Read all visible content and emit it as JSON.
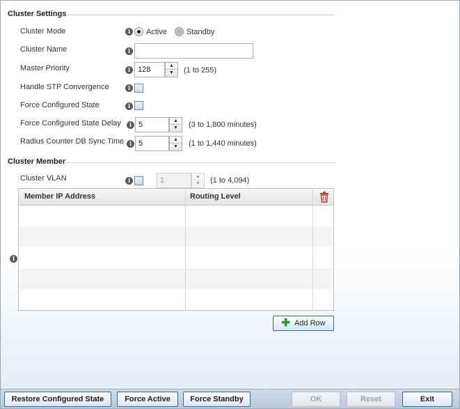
{
  "cluster_settings": {
    "title": "Cluster Settings",
    "cluster_mode": {
      "label": "Cluster Mode",
      "options": [
        "Active",
        "Standby"
      ],
      "selected": "Active"
    },
    "cluster_name": {
      "label": "Cluster Name",
      "value": ""
    },
    "master_priority": {
      "label": "Master Priority",
      "value": "128",
      "range": "(1 to 255)"
    },
    "handle_stp": {
      "label": "Handle STP Convergence",
      "checked": false
    },
    "force_configured_state": {
      "label": "Force Configured State",
      "checked": false
    },
    "force_configured_state_delay": {
      "label": "Force Configured State Delay",
      "value": "5",
      "range": "(3 to 1,800 minutes)"
    },
    "radius_sync_time": {
      "label": "Radius Counter DB Sync Time",
      "value": "5",
      "range": "(1 to 1,440 minutes)"
    }
  },
  "cluster_member": {
    "title": "Cluster Member",
    "cluster_vlan": {
      "label": "Cluster VLAN",
      "checked": false,
      "value": "1",
      "range": "(1 to 4,094)"
    },
    "table": {
      "columns": [
        "Member IP Address",
        "Routing Level"
      ],
      "rows": []
    },
    "add_row_label": "Add Row"
  },
  "footer": {
    "restore_label": "Restore Configured State",
    "force_active_label": "Force Active",
    "force_standby_label": "Force Standby",
    "ok_label": "OK",
    "reset_label": "Reset",
    "exit_label": "Exit"
  },
  "icons": {
    "info": "info-icon",
    "trash": "trash-icon",
    "add": "plus-icon"
  },
  "colors": {
    "accent": "#2d6aa6",
    "trash": "#c0392b",
    "add": "#2a9a2a"
  }
}
